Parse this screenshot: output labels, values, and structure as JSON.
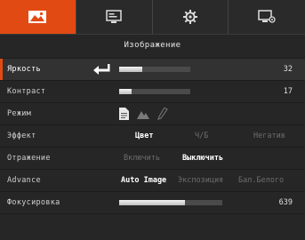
{
  "tabs": [
    {
      "name": "image-tab",
      "icon": "image-icon",
      "active": true
    },
    {
      "name": "display-tab",
      "icon": "screen-settings-icon",
      "active": false
    },
    {
      "name": "settings-tab",
      "icon": "gear-icon",
      "active": false
    },
    {
      "name": "monitor-tab",
      "icon": "monitor-settings-icon",
      "active": false
    }
  ],
  "section_title": "Изображение",
  "menu": {
    "brightness": {
      "label": "Яркость",
      "value": "32",
      "level": 0.32
    },
    "contrast": {
      "label": "Контраст",
      "value": "17",
      "level": 0.17
    },
    "mode": {
      "label": "Режим",
      "icons": [
        "document-icon",
        "mountain-icon",
        "pen-icon"
      ]
    },
    "effect": {
      "label": "Эффект",
      "options": [
        "Цвет",
        "Ч/Б",
        "Негатив"
      ],
      "selected": "Цвет"
    },
    "mirror": {
      "label": "Отражение",
      "options": [
        "Включить",
        "Выключить"
      ],
      "selected": "Выключить"
    },
    "advance": {
      "label": "Advance",
      "options": [
        "Auto Image",
        "Экспозиция",
        "Бал.Белого"
      ],
      "selected": "Auto Image"
    },
    "focus": {
      "label": "Фокусировка",
      "value": "639",
      "level": 0.639
    }
  },
  "colors": {
    "accent": "#e24a14",
    "background": "#262626",
    "text": "#cfcfcf"
  }
}
